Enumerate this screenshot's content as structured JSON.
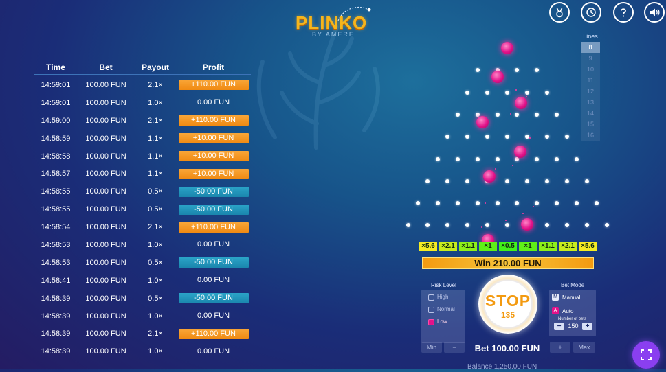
{
  "app": {
    "title": "PLINKO",
    "subtitle": "BY AMERE"
  },
  "top_icons": [
    "medal-icon",
    "history-icon",
    "help-icon",
    "sound-icon"
  ],
  "history": {
    "headers": {
      "time": "Time",
      "bet": "Bet",
      "payout": "Payout",
      "profit": "Profit"
    },
    "rows": [
      {
        "time": "14:59:01",
        "bet": "100.00 FUN",
        "payout": "2.1×",
        "profit": "+110.00 FUN",
        "type": "pos"
      },
      {
        "time": "14:59:01",
        "bet": "100.00 FUN",
        "payout": "1.0×",
        "profit": "0.00 FUN",
        "type": "zero"
      },
      {
        "time": "14:59:00",
        "bet": "100.00 FUN",
        "payout": "2.1×",
        "profit": "+110.00 FUN",
        "type": "pos"
      },
      {
        "time": "14:58:59",
        "bet": "100.00 FUN",
        "payout": "1.1×",
        "profit": "+10.00 FUN",
        "type": "pos"
      },
      {
        "time": "14:58:58",
        "bet": "100.00 FUN",
        "payout": "1.1×",
        "profit": "+10.00 FUN",
        "type": "pos"
      },
      {
        "time": "14:58:57",
        "bet": "100.00 FUN",
        "payout": "1.1×",
        "profit": "+10.00 FUN",
        "type": "pos"
      },
      {
        "time": "14:58:55",
        "bet": "100.00 FUN",
        "payout": "0.5×",
        "profit": "-50.00 FUN",
        "type": "neg"
      },
      {
        "time": "14:58:55",
        "bet": "100.00 FUN",
        "payout": "0.5×",
        "profit": "-50.00 FUN",
        "type": "neg"
      },
      {
        "time": "14:58:54",
        "bet": "100.00 FUN",
        "payout": "2.1×",
        "profit": "+110.00 FUN",
        "type": "pos"
      },
      {
        "time": "14:58:53",
        "bet": "100.00 FUN",
        "payout": "1.0×",
        "profit": "0.00 FUN",
        "type": "zero"
      },
      {
        "time": "14:58:53",
        "bet": "100.00 FUN",
        "payout": "0.5×",
        "profit": "-50.00 FUN",
        "type": "neg"
      },
      {
        "time": "14:58:41",
        "bet": "100.00 FUN",
        "payout": "1.0×",
        "profit": "0.00 FUN",
        "type": "zero"
      },
      {
        "time": "14:58:39",
        "bet": "100.00 FUN",
        "payout": "0.5×",
        "profit": "-50.00 FUN",
        "type": "neg"
      },
      {
        "time": "14:58:39",
        "bet": "100.00 FUN",
        "payout": "1.0×",
        "profit": "0.00 FUN",
        "type": "zero"
      },
      {
        "time": "14:58:39",
        "bet": "100.00 FUN",
        "payout": "2.1×",
        "profit": "+110.00 FUN",
        "type": "pos"
      },
      {
        "time": "14:58:39",
        "bet": "100.00 FUN",
        "payout": "1.0×",
        "profit": "0.00 FUN",
        "type": "zero"
      }
    ]
  },
  "lines": {
    "label": "Lines",
    "options": [
      "8",
      "9",
      "10",
      "11",
      "12",
      "13",
      "14",
      "15",
      "16"
    ],
    "selected": "8"
  },
  "multipliers": [
    "×5.6",
    "×2.1",
    "×1.1",
    "×1",
    "×0.5",
    "×1",
    "×1.1",
    "×2.1",
    "×5.6"
  ],
  "multiplier_colors": [
    "#f4ec23",
    "#c8ec1e",
    "#8ef01a",
    "#5ff018",
    "#42f21a",
    "#5ff018",
    "#8ef01a",
    "#c8ec1e",
    "#f4ec23"
  ],
  "win": {
    "text": "Win 210.00 FUN"
  },
  "risk": {
    "label": "Risk Level",
    "options": [
      "High",
      "Normal",
      "Low"
    ],
    "selected": "Low"
  },
  "stop": {
    "label": "STOP",
    "count": "135"
  },
  "mode": {
    "label": "Bet Mode",
    "manual": "Manual",
    "auto": "Auto",
    "manual_key": "M",
    "auto_key": "A",
    "number_of_bets_label": "Number of bets",
    "number_of_bets": "150",
    "minus": "−",
    "plus": "+"
  },
  "bet": {
    "text": "Bet 100.00 FUN",
    "min_label": "Min",
    "max_label": "Max",
    "minus": "−",
    "plus": "+"
  },
  "balance": {
    "text": "Balance 1,250.00 FUN"
  },
  "colors": {
    "accent_orange": "#f39a10",
    "profit_positive": "#f08a12",
    "profit_negative": "#1a86ad",
    "ball": "#e3128a",
    "fullscreen_button": "#8a3ff0"
  }
}
